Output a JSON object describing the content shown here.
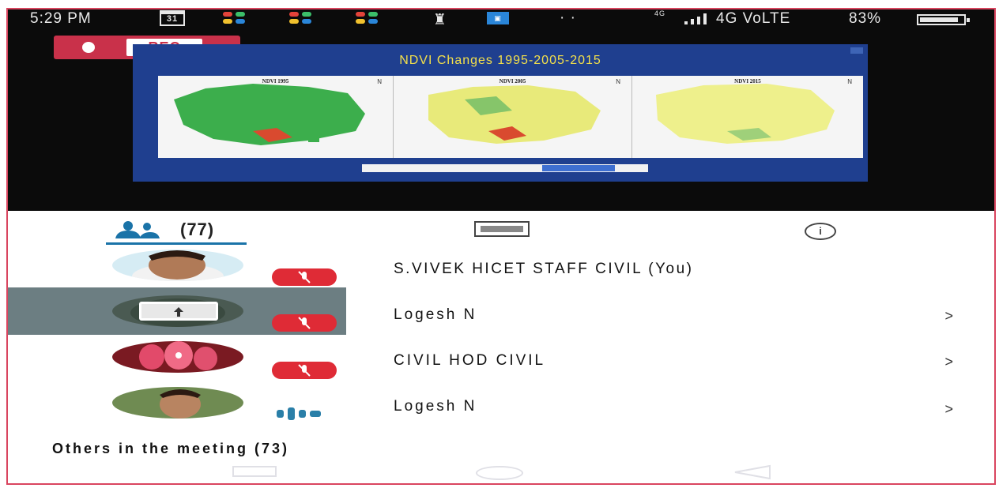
{
  "status_bar": {
    "time": "5:29 PM",
    "calendar_day": "31",
    "more": "· ·",
    "network_top": "4G",
    "network": "4G VoLTE",
    "battery": "83%"
  },
  "recording": {
    "label": "REC"
  },
  "presentation": {
    "title": "NDVI Changes 1995-2005-2015",
    "panels": [
      {
        "title": "NDVI 1995",
        "compass": "N"
      },
      {
        "title": "NDVI 2005",
        "compass": "N"
      },
      {
        "title": "NDVI 2015",
        "compass": "N"
      }
    ]
  },
  "tabs": {
    "people_count": "(77)"
  },
  "participants": [
    {
      "name": "S.VIVEK HICET STAFF CIVIL (You)",
      "muted": true,
      "chevron": ""
    },
    {
      "name": "Logesh N",
      "muted": true,
      "chevron": ">"
    },
    {
      "name": "CIVIL HOD CIVIL",
      "muted": true,
      "chevron": ">"
    },
    {
      "name": "Logesh N",
      "muted": false,
      "chevron": ">"
    }
  ],
  "others": {
    "label": "Others in the meeting (73)"
  },
  "colors": {
    "accent": "#1a73a8",
    "mute_red": "#df2b36",
    "rec_red": "#c9314a",
    "slide_blue": "#1f3f8f",
    "slide_title": "#f4e04a"
  },
  "icons": {
    "people_tab": "people-icon",
    "chat_tab": "chat-icon",
    "info_tab": "info-icon",
    "mic_off": "mic-off-icon",
    "present": "present-icon",
    "speaking": "speaking-icon"
  }
}
